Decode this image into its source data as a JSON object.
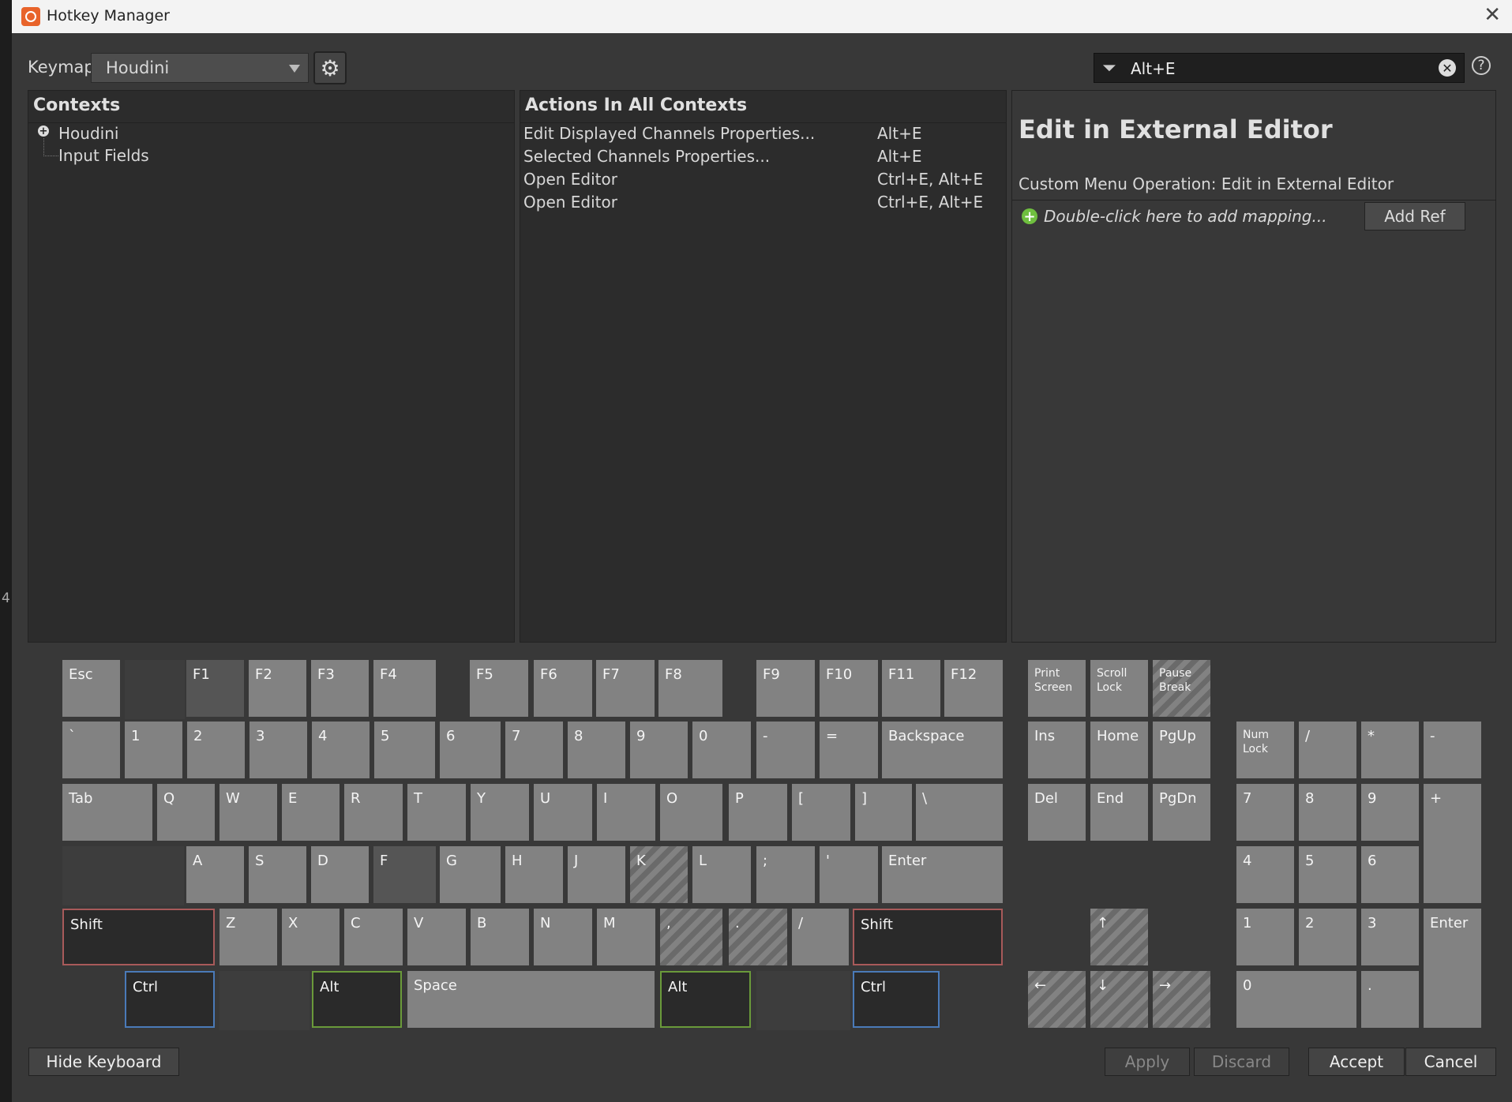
{
  "window": {
    "title": "Hotkey Manager",
    "edge_text": "4"
  },
  "toolbar": {
    "keymap_label": "Keymap",
    "keymap_value": "Houdini",
    "search_value": "Alt+E",
    "help": "?"
  },
  "contexts": {
    "header": "Contexts",
    "items": [
      "Houdini",
      "Input Fields"
    ]
  },
  "actions": {
    "header": "Actions In All Contexts",
    "rows": [
      {
        "name": "Edit Displayed Channels Properties...",
        "keys": "Alt+E"
      },
      {
        "name": "Selected Channels Properties...",
        "keys": "Alt+E"
      },
      {
        "name": "Open Editor",
        "keys": "Ctrl+E, Alt+E"
      },
      {
        "name": "Open Editor",
        "keys": "Ctrl+E, Alt+E"
      }
    ]
  },
  "detail": {
    "title": "Edit in External Editor",
    "subtitle": "Custom Menu Operation: Edit in External Editor",
    "add_mapping": "Double-click here to add mapping...",
    "add_ref": "Add Ref"
  },
  "keyboard": {
    "keys": [
      "Esc",
      "F1",
      "F2",
      "F3",
      "F4",
      "F5",
      "F6",
      "F7",
      "F8",
      "F9",
      "F10",
      "F11",
      "F12",
      "`",
      "1",
      "2",
      "3",
      "4",
      "5",
      "6",
      "7",
      "8",
      "9",
      "0",
      "-",
      "=",
      "Backspace",
      "Tab",
      "Q",
      "W",
      "E",
      "R",
      "T",
      "Y",
      "U",
      "I",
      "O",
      "P",
      "[",
      "]",
      "\\",
      "A",
      "S",
      "D",
      "F",
      "G",
      "H",
      "J",
      "K",
      "L",
      ";",
      "'",
      "Enter",
      "Shift",
      "Z",
      "X",
      "C",
      "V",
      "B",
      "N",
      "M",
      ",",
      ".",
      "/",
      "Shift",
      "Ctrl",
      "Alt",
      "Space",
      "Alt",
      "Ctrl",
      "Print Screen",
      "Scroll Lock",
      "Pause Break",
      "Ins",
      "Home",
      "PgUp",
      "Del",
      "End",
      "PgDn",
      "↑",
      "←",
      "↓",
      "→",
      "Num Lock",
      "/",
      "*",
      "-",
      "7",
      "8",
      "9",
      "+",
      "4",
      "5",
      "6",
      "1",
      "2",
      "3",
      "Enter",
      "0",
      "."
    ]
  },
  "footer": {
    "hide_keyboard": "Hide Keyboard",
    "apply": "Apply",
    "discard": "Discard",
    "accept": "Accept",
    "cancel": "Cancel"
  }
}
